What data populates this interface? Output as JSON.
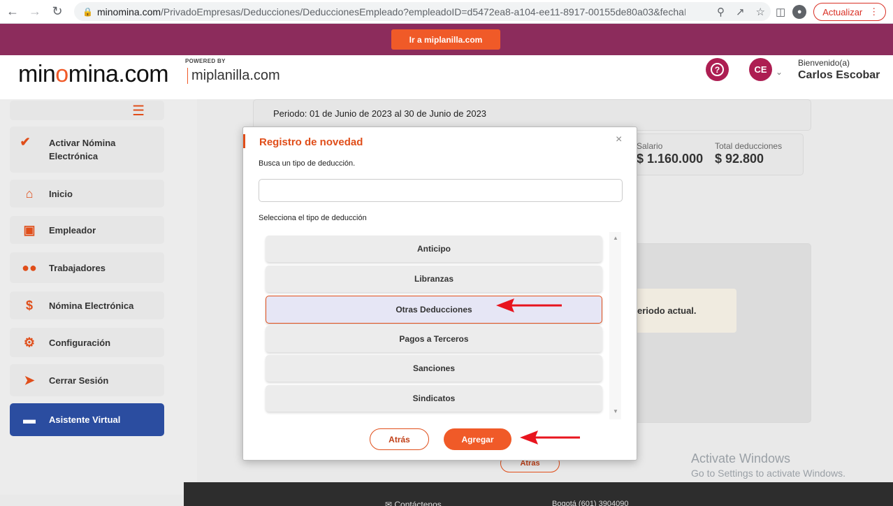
{
  "browser": {
    "url_host": "minomina.com",
    "url_path": "/PrivadoEmpresas/Deducciones/DeduccionesEmpleado?empleadoID=d5472ea8-a104-ee11-8917-00155de80a03&fechaIni...",
    "update_label": "Actualizar"
  },
  "banner": {
    "button_label": "Ir a miplanilla.com"
  },
  "header": {
    "logo_text_pre": "min",
    "logo_text_o": "o",
    "logo_text_post": "mina.com",
    "powered_by": "POWERED BY",
    "partner": "miplanilla.com",
    "user_initials": "CE",
    "welcome": "Bienvenido(a)",
    "user_name": "Carlos Escobar"
  },
  "sidebar": {
    "items": [
      {
        "label": "Activar Nómina Electrónica",
        "icon": "check-icon"
      },
      {
        "label": "Inicio",
        "icon": "home-icon"
      },
      {
        "label": "Empleador",
        "icon": "badge-icon"
      },
      {
        "label": "Trabajadores",
        "icon": "users-icon"
      },
      {
        "label": "Nómina Electrónica",
        "icon": "dollar-icon"
      },
      {
        "label": "Configuración",
        "icon": "gear-icon"
      },
      {
        "label": "Cerrar Sesión",
        "icon": "logout-icon"
      },
      {
        "label": "Asistente Virtual",
        "icon": "chat-icon"
      }
    ]
  },
  "background": {
    "periodo": "Periodo: 01 de Junio de 2023 al 30 de Junio de 2023",
    "salario_label": "Salario",
    "salario_value": "$ 1.160.000",
    "total_label": "Total deducciones",
    "total_value": "$ 92.800",
    "message": "eriodo actual.",
    "atras_label": "Atras",
    "footer_contact": "Contáctenos",
    "footer_phone": "Bogotá (601) 3904090"
  },
  "modal": {
    "title": "Registro de novedad",
    "search_label": "Busca un tipo de deducción.",
    "search_value": "",
    "search_placeholder": "",
    "select_label": "Selecciona el tipo de deducción",
    "options": [
      "Anticipo",
      "Libranzas",
      "Otras Deducciones",
      "Pagos a Terceros",
      "Sanciones",
      "Sindicatos"
    ],
    "selected_option": "Otras Deducciones",
    "back_label": "Atrás",
    "add_label": "Agregar"
  },
  "watermark": {
    "line1": "Activate Windows",
    "line2": "Go to Settings to activate Windows."
  },
  "colors": {
    "accent": "#f05a28",
    "brand": "#8c2c5c",
    "assist": "#2b4da0"
  }
}
